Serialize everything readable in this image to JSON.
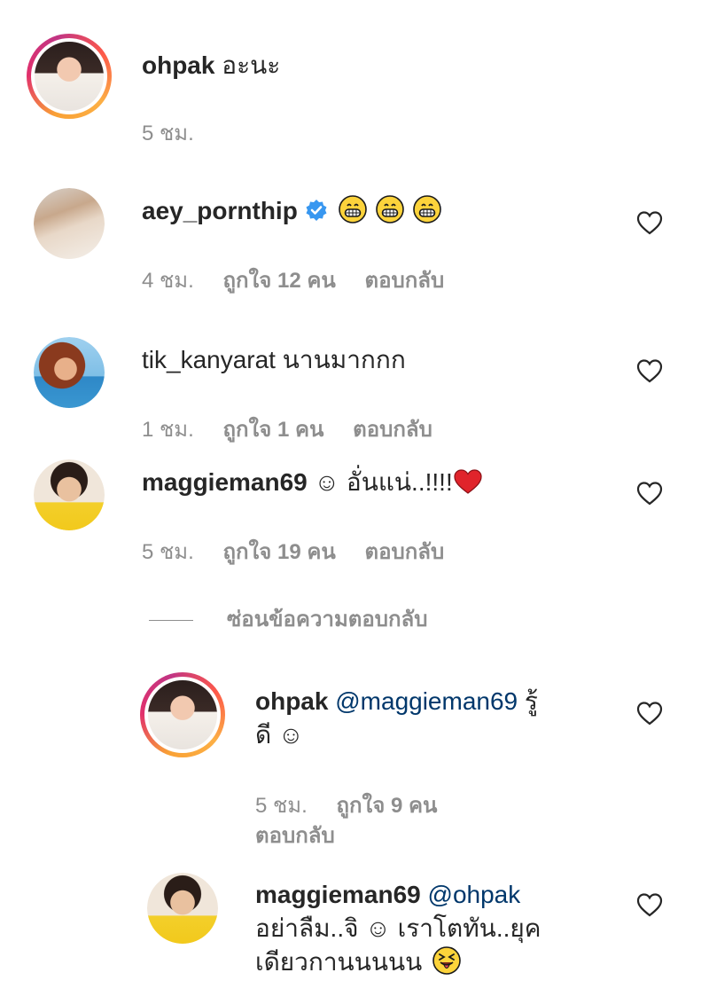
{
  "comments": [
    {
      "username": "ohpak",
      "text": "อะนะ",
      "time": "5 ชม.",
      "avatar_icon": "woman-portrait-avatar"
    },
    {
      "username": "aey_pornthip",
      "verified_icon": "verified-badge-icon",
      "emoji": [
        "grinning-face-emoji",
        "grinning-face-emoji",
        "grinning-face-emoji"
      ],
      "time": "4 ชม.",
      "likes": "ถูกใจ 12 คน",
      "reply": "ตอบกลับ",
      "avatar_icon": "woman-portrait-avatar"
    },
    {
      "username": "tik_kanyarat",
      "text": "นานมากกก",
      "time": "1 ชม.",
      "likes": "ถูกใจ 1 คน",
      "reply": "ตอบกลับ",
      "avatar_icon": "woman-beach-avatar"
    },
    {
      "username": "maggieman69",
      "text": "☺ อั่นแน่..!!!!",
      "time": "5 ชม.",
      "likes": "ถูกใจ 19 คน",
      "reply": "ตอบกลับ",
      "avatar_icon": "man-yellow-shirt-avatar"
    }
  ],
  "hide_replies": "ซ่อนข้อความตอบกลับ",
  "replies": [
    {
      "username": "ohpak",
      "mention": "@maggieman69",
      "text_line1_suffix": "รู้",
      "text_line2": "ดี ☺",
      "time": "5 ชม.",
      "likes": "ถูกใจ 9 คน",
      "reply": "ตอบกลับ"
    },
    {
      "username": "maggieman69",
      "mention": "@ohpak",
      "text_line2": "อย่าลืม..จิ ☺ เราโตทัน..ยุค",
      "text_line3": "เดียวกานนนนน",
      "emoji": "squinting-tongue-emoji"
    }
  ],
  "colors": {
    "text": "#262626",
    "meta": "#8e8e8e",
    "mention": "#00376b",
    "verified": "#3897f0"
  }
}
